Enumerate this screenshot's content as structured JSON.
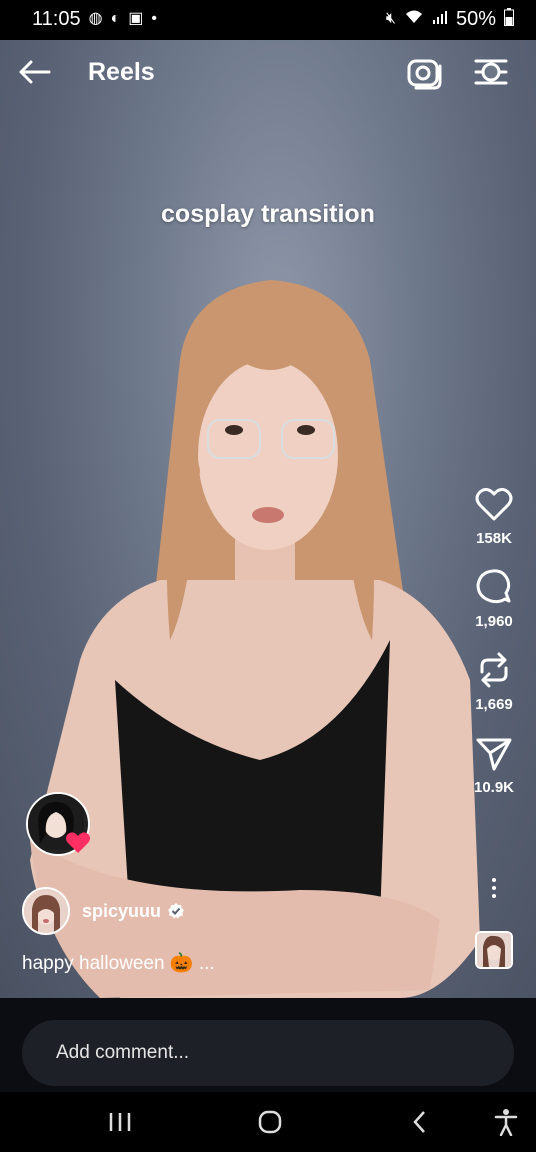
{
  "status_bar": {
    "time": "11:05",
    "battery": "50%",
    "icons_left": [
      "chrome-icon",
      "discord-icon",
      "gallery-icon",
      "dot-icon"
    ],
    "icons_right": [
      "mute-icon",
      "wifi-icon",
      "signal-icon",
      "battery-icon"
    ]
  },
  "header": {
    "title": "Reels"
  },
  "video": {
    "overlay_text": "cosplay transition"
  },
  "actions": {
    "likes": "158K",
    "comments": "1,960",
    "reposts": "1,669",
    "shares": "10.9K"
  },
  "post": {
    "username": "spicyuuu",
    "caption": "happy halloween 🎃 ..."
  },
  "comment": {
    "placeholder": "Add comment..."
  },
  "colors": {
    "accent_heart": "#ff2e63",
    "background": "#000000",
    "comment_box": "#1e2027"
  }
}
